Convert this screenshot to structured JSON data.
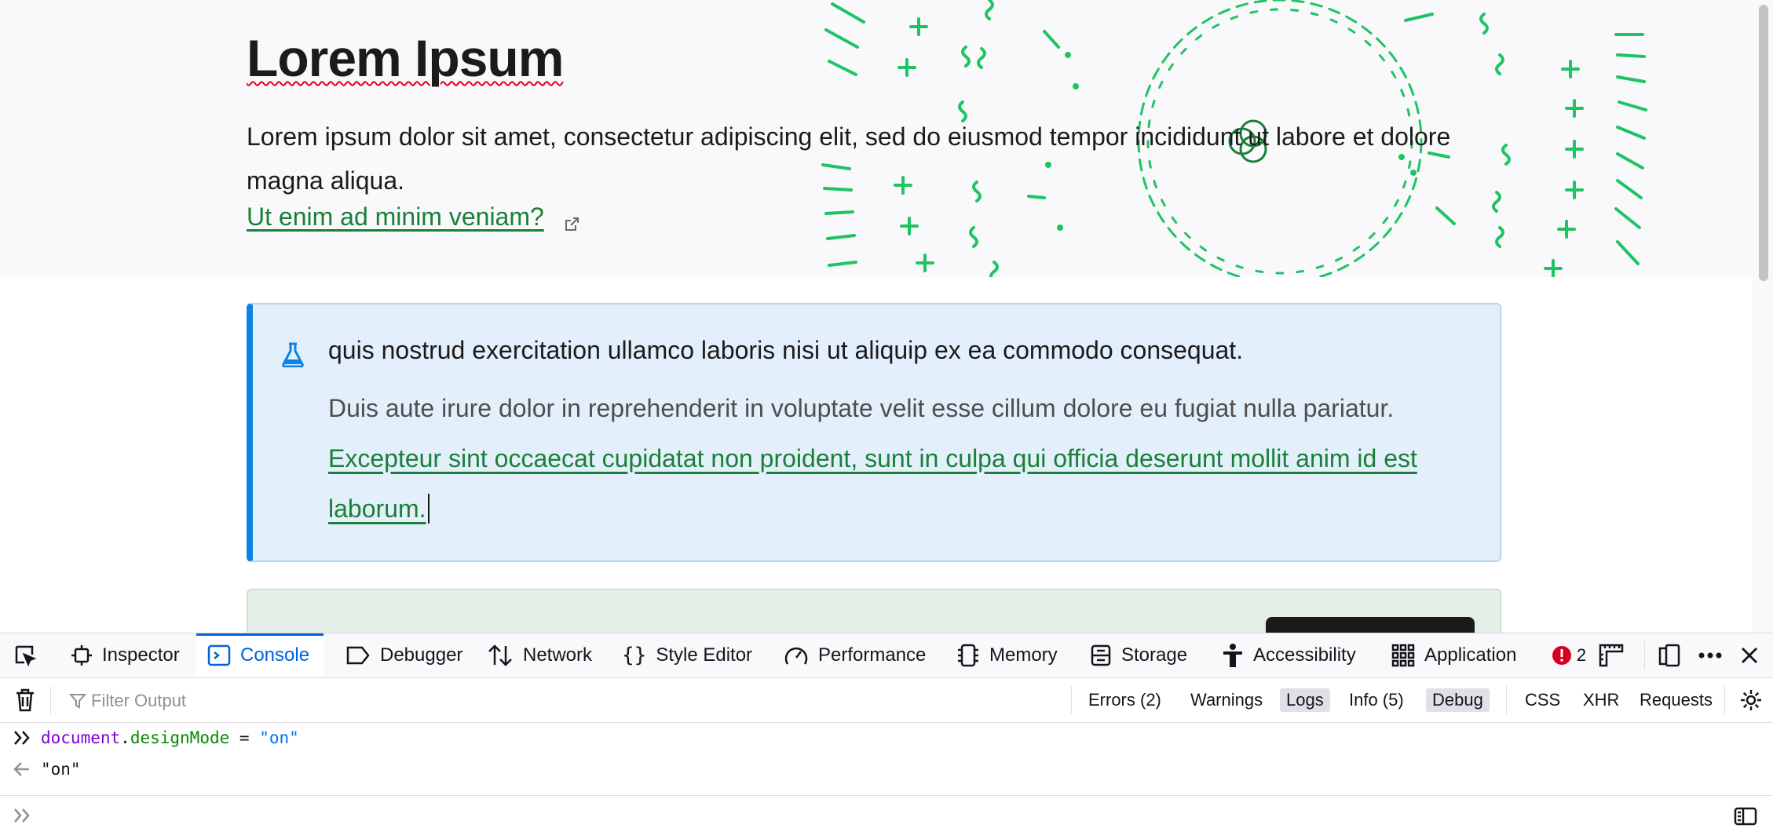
{
  "page": {
    "hero": {
      "title": "Lorem Ipsum",
      "text": "Lorem ipsum dolor sit amet, consectetur adipiscing elit, sed do eiusmod tempor incididunt ut labore et dolore magna aliqua.",
      "link": "Ut enim ad minim veniam?"
    },
    "note": {
      "heading": "quis nostrud exercitation ullamco laboris nisi ut aliquip ex ea commodo consequat.",
      "body": "Duis aute irure dolor in reprehenderit in voluptate velit esse cillum dolore eu fugiat nulla pariatur.",
      "link": "Excepteur sint occaecat cupidatat non proident, sunt in culpa qui officia deserunt mollit anim id est laborum."
    },
    "colors": {
      "accent_green": "#1a7f37",
      "note_bg": "#e3f0fc",
      "note_border": "#0b83e8"
    }
  },
  "devtools": {
    "tabs": [
      {
        "label": "Inspector",
        "icon": "inspector-icon"
      },
      {
        "label": "Console",
        "icon": "console-icon",
        "active": true
      },
      {
        "label": "Debugger",
        "icon": "debugger-icon"
      },
      {
        "label": "Network",
        "icon": "network-icon"
      },
      {
        "label": "Style Editor",
        "icon": "style-editor-icon"
      },
      {
        "label": "Performance",
        "icon": "performance-icon"
      },
      {
        "label": "Memory",
        "icon": "memory-icon"
      },
      {
        "label": "Storage",
        "icon": "storage-icon"
      },
      {
        "label": "Accessibility",
        "icon": "accessibility-icon"
      },
      {
        "label": "Application",
        "icon": "application-icon"
      }
    ],
    "error_count": "2",
    "filter": {
      "placeholder": "Filter Output",
      "value": ""
    },
    "filters": {
      "errors": "Errors (2)",
      "warnings": "Warnings",
      "logs": "Logs",
      "info": "Info (5)",
      "debug": "Debug",
      "css": "CSS",
      "xhr": "XHR",
      "requests": "Requests"
    },
    "console": {
      "input": {
        "object": "document",
        "dot": ".",
        "property": "designMode",
        "op": " = ",
        "value": "\"on\""
      },
      "result": "\"on\""
    }
  }
}
